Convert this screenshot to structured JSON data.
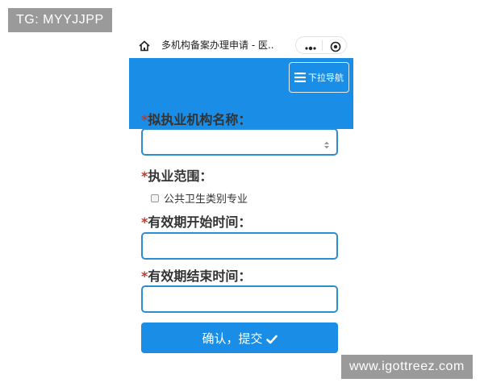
{
  "overlay": {
    "top_left_tag": "TG: MYYJJPP",
    "bottom_right_watermark": "www.igottreez.com"
  },
  "miniapp": {
    "page_title": "多机构备案办理申请 - 医...",
    "nav_button_label": "下拉导航",
    "icons": {
      "home": "home-icon",
      "more": "more-dots-icon",
      "close": "close-target-icon",
      "menu": "hamburger-icon",
      "select": "select-arrows-icon",
      "submit": "check-icon"
    }
  },
  "form": {
    "required_mark": "*",
    "institution": {
      "label": "拟执业机构名称：",
      "value": ""
    },
    "scope": {
      "label": "执业范围：",
      "options": [
        {
          "label": "公共卫生类别专业",
          "checked": false
        }
      ]
    },
    "start_date": {
      "label": "有效期开始时间：",
      "value": ""
    },
    "end_date": {
      "label": "有效期结束时间：",
      "value": ""
    },
    "submit_label": "确认，提交"
  },
  "colors": {
    "primary": "#1a8de6",
    "input_border": "#2b8ed0",
    "required": "#c0392b",
    "badge_bg": "#9a9a9a"
  }
}
